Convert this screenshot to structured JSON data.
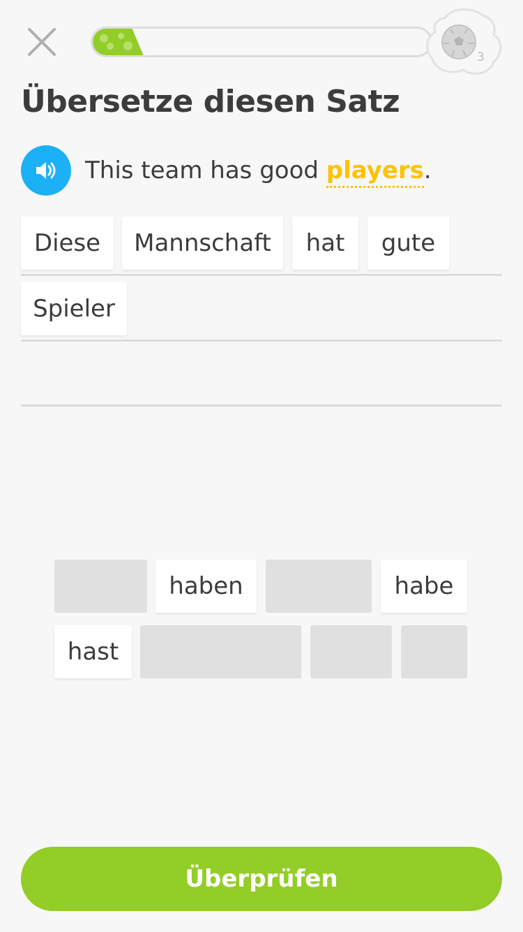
{
  "header": {
    "progress_fraction": 0.15,
    "streak_count": "3",
    "streak_icon": "soccer-ball-icon",
    "close_icon": "close-icon"
  },
  "exercise": {
    "title": "Übersetze diesen Satz",
    "speaker_icon": "speaker-icon",
    "prompt_before": "This team has good ",
    "prompt_hint_word": "players",
    "prompt_after": "."
  },
  "answer_tiles": [
    "Diese",
    "Mannschaft",
    "hat",
    "gute",
    "Spieler"
  ],
  "word_bank": [
    "haben",
    "habe",
    "hast"
  ],
  "check_button_label": "Überprüfen",
  "colors": {
    "accent_green": "#93cd27",
    "speaker_blue": "#1cb0f6",
    "hint_yellow": "#ffc200"
  }
}
